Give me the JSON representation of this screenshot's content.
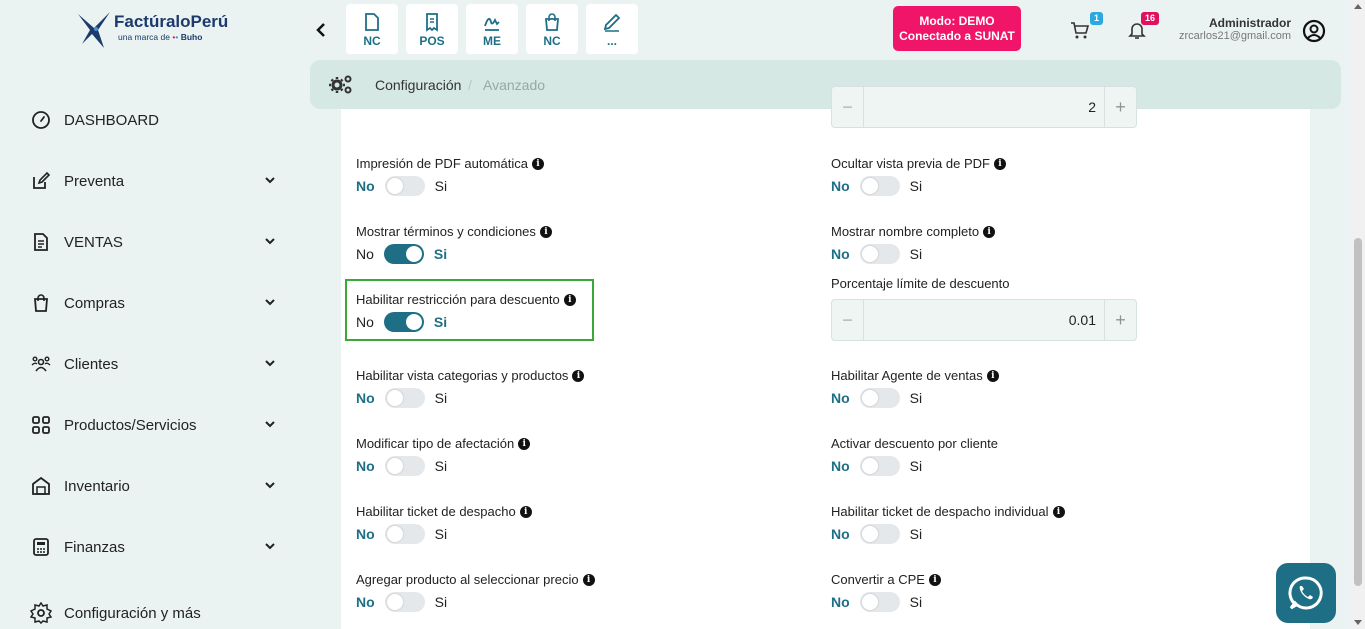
{
  "brand": {
    "name": "FactúraloPerú",
    "sub_prefix": "una marca de",
    "sub_brand": "Buho"
  },
  "sidebar": {
    "items": [
      {
        "label": "DASHBOARD",
        "icon": "gauge-icon"
      },
      {
        "label": "Preventa",
        "icon": "edit-icon"
      },
      {
        "label": "VENTAS",
        "icon": "document-icon"
      },
      {
        "label": "Compras",
        "icon": "shopping-bag-icon"
      },
      {
        "label": "Clientes",
        "icon": "users-icon"
      },
      {
        "label": "Productos/Servicios",
        "icon": "grid-icon"
      },
      {
        "label": "Inventario",
        "icon": "warehouse-icon"
      },
      {
        "label": "Finanzas",
        "icon": "calculator-icon"
      },
      {
        "label": "Configuración y más",
        "icon": "gear-icon"
      }
    ]
  },
  "quick": [
    {
      "label": "NC",
      "icon": "file-icon"
    },
    {
      "label": "POS",
      "icon": "receipt-icon"
    },
    {
      "label": "ME",
      "icon": "signature-icon"
    },
    {
      "label": "NC",
      "icon": "shopping-bag-icon"
    },
    {
      "label": "...",
      "icon": "pen-icon"
    }
  ],
  "mode": {
    "line1": "Modo: DEMO",
    "line2": "Conectado a SUNAT"
  },
  "header": {
    "cart_count": "1",
    "notif_count": "16",
    "user_name": "Administrador",
    "user_email": "zrcarlos21@gmail.com"
  },
  "breadcrumb": {
    "current": "Configuración",
    "sep": "/",
    "next": "Avanzado"
  },
  "toggle_text": {
    "no": "No",
    "si": "Si"
  },
  "settings_left": [
    {
      "label": "Impresión de PDF automática",
      "on": false
    },
    {
      "label": "Mostrar términos y condiciones",
      "on": true
    },
    {
      "label": "Habilitar restricción para descuento",
      "on": true
    },
    {
      "label": "Habilitar vista categorias y productos",
      "on": false
    },
    {
      "label": "Modificar tipo de afectación",
      "on": false
    },
    {
      "label": "Habilitar ticket de despacho",
      "on": false
    },
    {
      "label": "Agregar producto al seleccionar precio",
      "on": false
    }
  ],
  "settings_right": [
    {
      "label": "Ocultar vista previa de PDF",
      "on": false
    },
    {
      "label": "Mostrar nombre completo",
      "on": false
    },
    {
      "label": "Habilitar Agente de ventas",
      "on": false
    },
    {
      "label": "Activar descuento por cliente",
      "on": false
    },
    {
      "label": "Habilitar ticket de despacho individual",
      "on": false
    },
    {
      "label": "Convertir a CPE",
      "on": false
    }
  ],
  "top_stepper": {
    "value": "2"
  },
  "discount": {
    "label": "Porcentaje límite de descuento",
    "value": "0.01"
  },
  "colors": {
    "accent": "#1e6f86",
    "mode_bg": "#f1156a",
    "highlight": "#3aa93a"
  }
}
